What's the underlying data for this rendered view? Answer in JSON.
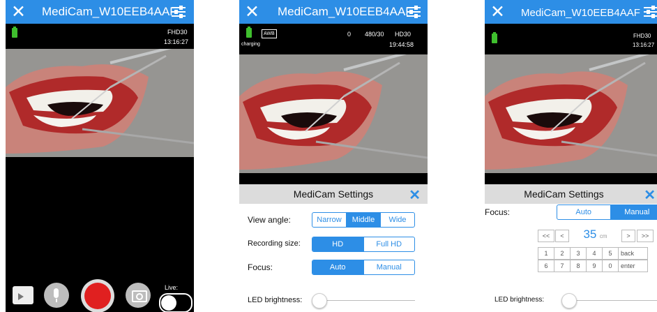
{
  "colors": {
    "accent": "#2d8ee6",
    "record": "#e02020",
    "battery": "#3fbf2e"
  },
  "screen1": {
    "title": "MediCam_W10EEB4AAF",
    "close_icon": "close-icon",
    "menu_icon": "settings-sliders-icon",
    "resolution": "FHD30",
    "time": "13:16:27",
    "live_label": "Live:",
    "buttons": [
      "gallery-folder-icon",
      "microphone-icon",
      "record-button",
      "camera-icon",
      "live-toggle"
    ]
  },
  "screen2": {
    "title": "MediCam_W10EEB4AAF",
    "awb": "AWB",
    "charging": "charging",
    "counter": "0",
    "fps": "480/30",
    "resolution": "HD30",
    "time": "19:44:58",
    "settings": {
      "title": "MediCam Settings",
      "view_angle_label": "View angle:",
      "view_angle_options": [
        "Narrow",
        "Middle",
        "Wide"
      ],
      "view_angle_selected": "Middle",
      "recording_size_label": "Recording size:",
      "recording_size_options": [
        "HD",
        "Full HD"
      ],
      "recording_size_selected": "HD",
      "focus_label": "Focus:",
      "focus_options": [
        "Auto",
        "Manual"
      ],
      "focus_selected": "Auto",
      "led_label": "LED brightness:",
      "led_level": 0
    }
  },
  "screen3": {
    "title": "MediCam_W10EEB4AAF",
    "resolution": "FHD30",
    "time": "13:16:27",
    "settings": {
      "title": "MediCam Settings",
      "focus_label": "Focus:",
      "focus_options": [
        "Auto",
        "Manual"
      ],
      "focus_selected": "Manual",
      "focus_value": "35",
      "focus_unit": "cm",
      "nav": [
        "<<",
        "<",
        ">",
        ">>"
      ],
      "keys_row1": [
        "1",
        "2",
        "3",
        "4",
        "5",
        "back"
      ],
      "keys_row2": [
        "6",
        "7",
        "8",
        "9",
        "0",
        "enter"
      ],
      "led_label": "LED brightness:",
      "led_level": 0
    }
  }
}
